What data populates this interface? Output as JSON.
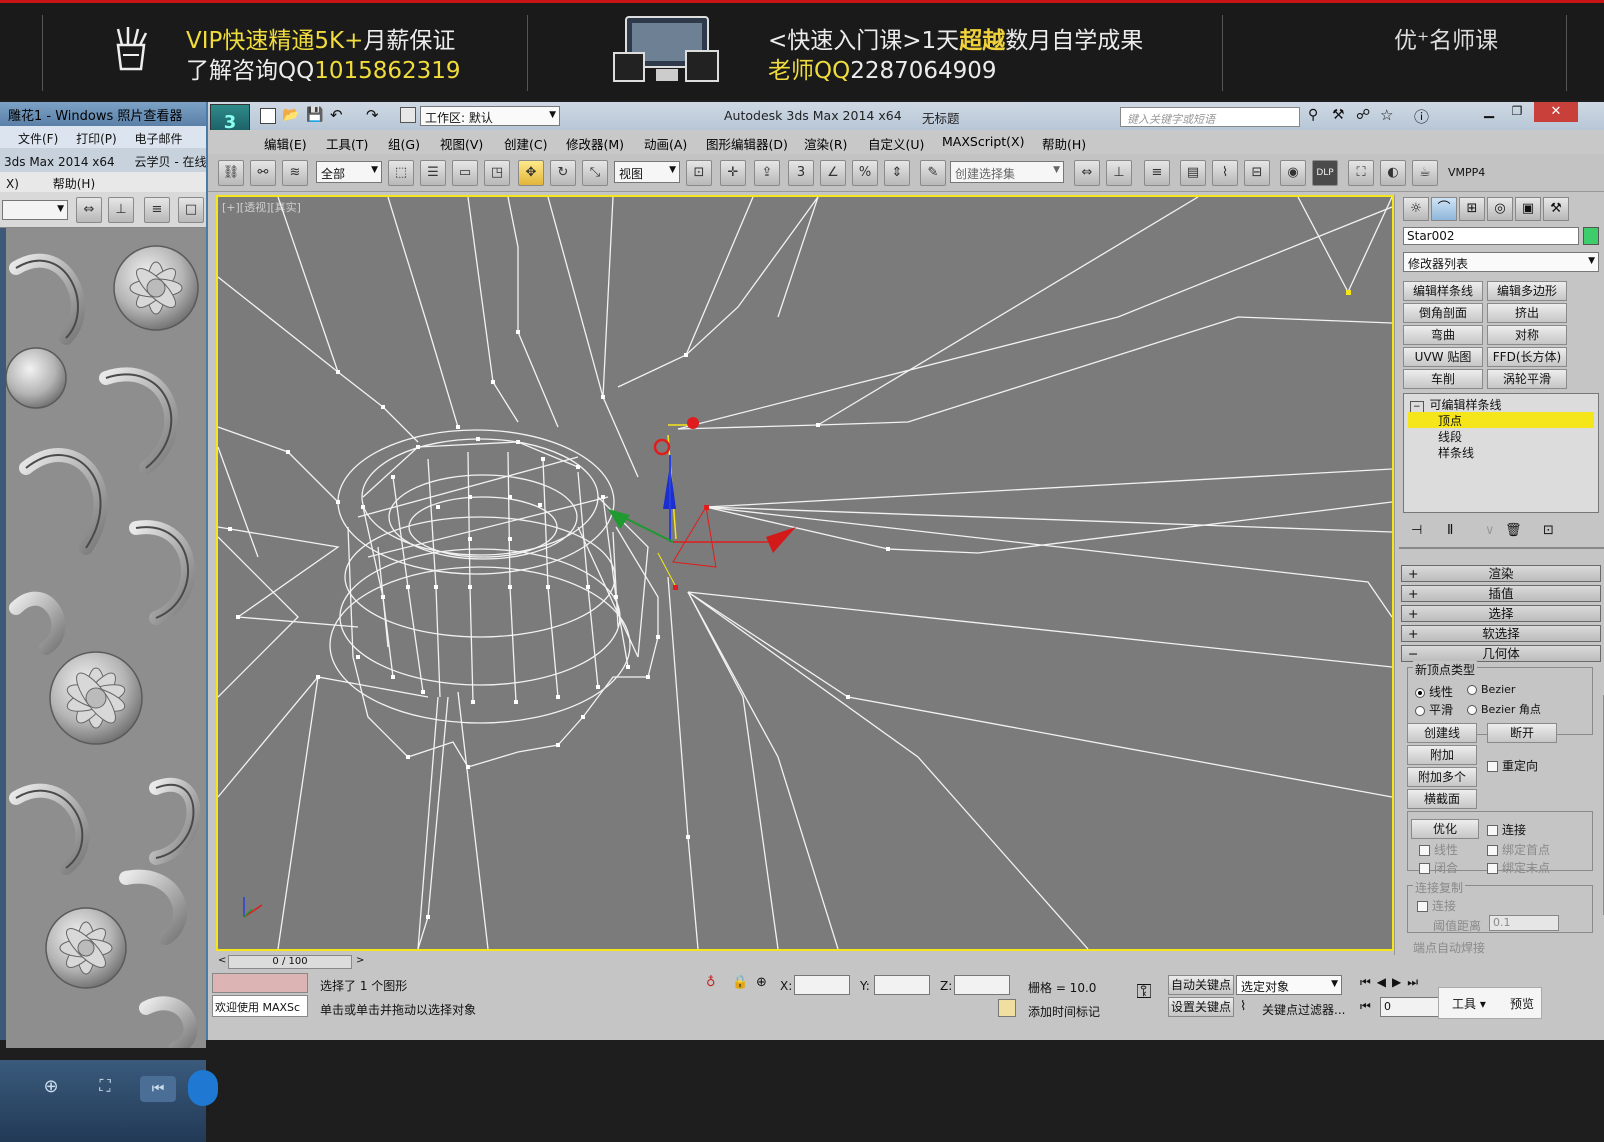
{
  "banner": {
    "left_line1_a": "VIP快速精通",
    "left_line1_b": "5K+",
    "left_line1_c": "月薪保证",
    "left_line2_a": "了解咨询QQ",
    "left_line2_b": "1015862319",
    "mid_line1_a": "<快速入门课>1天",
    "mid_line1_b": "超越",
    "mid_line1_c": "数月自学成果",
    "mid_line2_a": "老师QQ",
    "mid_line2_b": "2287064909",
    "right_text": "优⁺名师课"
  },
  "photo_viewer": {
    "title": "雕花1 - Windows 照片查看器",
    "menu": [
      "文件(F)",
      "打印(P)",
      "电子邮件"
    ],
    "taskbar": [
      "3ds Max  2014 x64",
      "云学贝 - 在线"
    ],
    "menu2": [
      "X)",
      "帮助(H)"
    ]
  },
  "max": {
    "title": "Autodesk 3ds Max  2014 x64",
    "title_file": "无标题",
    "workspace": "工作区: 默认",
    "search_placeholder": "键入关键字或短语",
    "menus": [
      "编辑(E)",
      "工具(T)",
      "组(G)",
      "视图(V)",
      "创建(C)",
      "修改器(M)",
      "动画(A)",
      "图形编辑器(D)",
      "渲染(R)",
      "自定义(U)",
      "MAXScript(X)",
      "帮助(H)"
    ],
    "selection_filter": "全部",
    "ref_coord": "视图",
    "named_set": "创建选择集",
    "vmpp_label": "VMPP4",
    "viewport_label": "[+][透视][真实]"
  },
  "command_panel": {
    "object_name": "Star002",
    "modifier_list": "修改器列表",
    "modifier_buttons": [
      "编辑样条线",
      "编辑多边形",
      "倒角剖面",
      "挤出",
      "弯曲",
      "对称",
      "UVW 贴图",
      "FFD(长方体)",
      "车削",
      "涡轮平滑"
    ],
    "stack": {
      "root": "可编辑样条线",
      "items": [
        "顶点",
        "线段",
        "样条线"
      ],
      "selected": "顶点"
    },
    "rollouts": [
      "渲染",
      "插值",
      "选择",
      "软选择",
      "几何体"
    ],
    "geometry": {
      "new_vertex_type": "新顶点类型",
      "linear": "线性",
      "bezier": "Bezier",
      "smooth": "平滑",
      "bezier_corner": "Bezier 角点",
      "create_line": "创建线",
      "break": "断开",
      "attach": "附加",
      "attach_multi": "附加多个",
      "reorient": "重定向",
      "cross_section": "横截面",
      "refine": "优化",
      "connect": "连接",
      "linear2": "线性",
      "bind_first": "绑定首点",
      "closed": "闭合",
      "bind_last": "绑定末点",
      "connect_copy": "连接复制",
      "connect2": "连接",
      "threshold_label": "阈值距离",
      "threshold_value": "0.1",
      "endpoint_auto_weld": "端点自动焊接"
    },
    "accent_color": "#3fcc6a",
    "selected_stack_color": "#f5e61b"
  },
  "status": {
    "time_slider": "0 / 100",
    "welcome": "欢迎使用 MAXSc",
    "selected_msg": "选择了 1 个图形",
    "prompt": "单击或单击并拖动以选择对象",
    "x_label": "X:",
    "y_label": "Y:",
    "z_label": "Z:",
    "grid": "栅格 = 10.0",
    "add_time_tag": "添加时间标记",
    "auto_key": "自动关键点",
    "set_key": "设置关键点",
    "selected_object": "选定对象",
    "key_filters": "关键点过滤器...",
    "frame": "0",
    "tools_btn": "工具",
    "preview_btn": "预览"
  },
  "colors": {
    "viewport_bg": "#7b7b7b",
    "viewport_border": "#f5e61b",
    "banner_highlight": "#f0dc3c"
  }
}
